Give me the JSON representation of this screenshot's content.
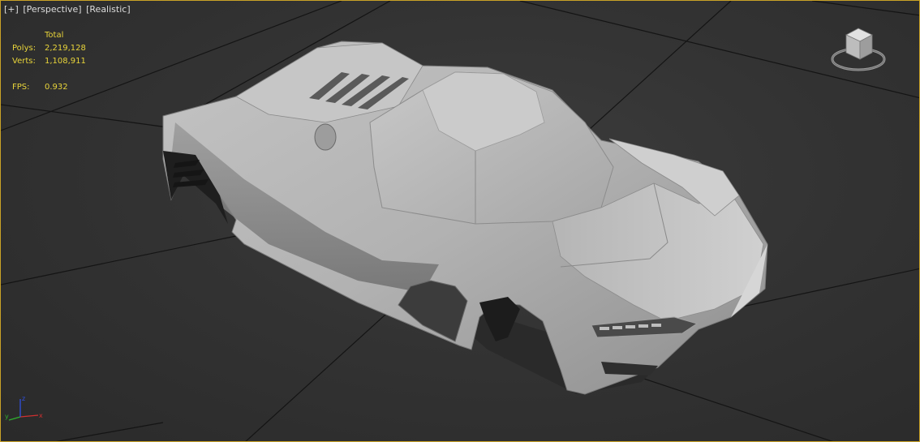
{
  "viewport": {
    "labels": {
      "plus": "[+]",
      "view": "[Perspective]",
      "shading": "[Realistic]"
    },
    "stats": {
      "header": "Total",
      "polys_label": "Polys:",
      "polys_value": "2,219,128",
      "verts_label": "Verts:",
      "verts_value": "1,108,911",
      "fps_label": "FPS:",
      "fps_value": "0.932"
    },
    "gizmo": {
      "x_label": "x",
      "y_label": "y",
      "z_label": "z"
    }
  },
  "colors": {
    "stat_text": "#e8d43a",
    "label_text": "#dcdcdc",
    "background": "#333333",
    "grid": "#151515",
    "model": "#b8b8b8",
    "active_border": "#c9a227"
  },
  "icons": {
    "viewcube": "viewcube-icon",
    "axis": "axis-tripod-icon"
  }
}
